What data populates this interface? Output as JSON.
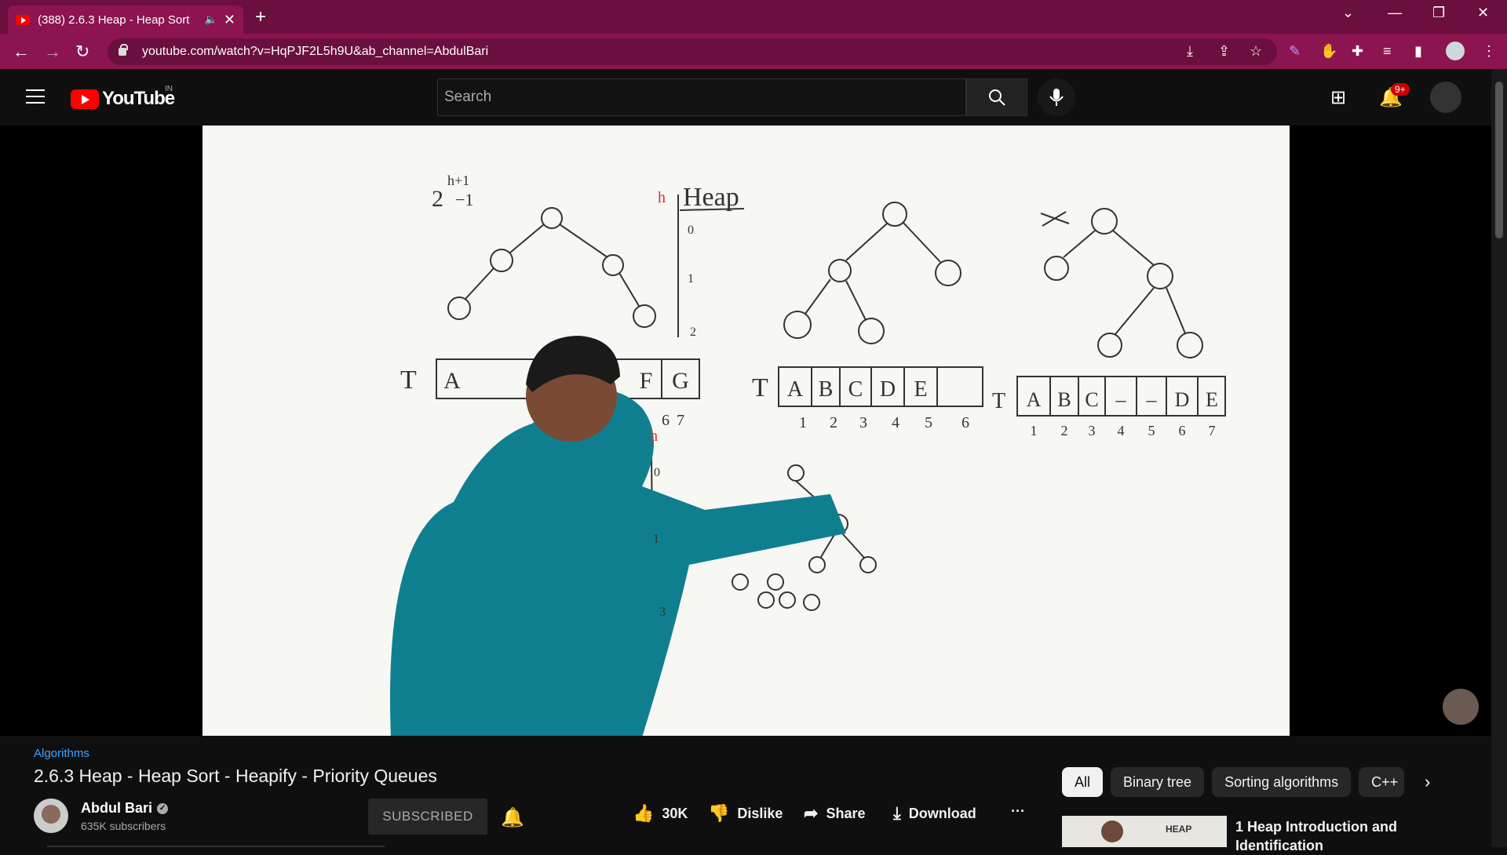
{
  "browser": {
    "tab_title": "(388) 2.6.3 Heap - Heap Sort",
    "url": "youtube.com/watch?v=HqPJF2L5h9U&ab_channel=AbdulBari",
    "theme_color": "#8c1450"
  },
  "youtube": {
    "logo_text": "YouTube",
    "country_code": "IN",
    "search_placeholder": "Search",
    "notifications_badge": "9+"
  },
  "video": {
    "hashtag": "Algorithms",
    "title": "2.6.3 Heap - Heap Sort - Heapify - Priority Queues",
    "board": {
      "heading": "Heap",
      "formula": "2",
      "formula_exp": "h+1",
      "formula_rest": "−1",
      "array1_label": "T",
      "array1_cells": [
        "A",
        "",
        "",
        "",
        "F",
        "G"
      ],
      "array1_indices": [
        "",
        "",
        "",
        "",
        "6",
        "7"
      ],
      "array2_label": "T",
      "array2_cells": [
        "A",
        "B",
        "C",
        "D",
        "E",
        ""
      ],
      "array2_indices": [
        "1",
        "2",
        "3",
        "4",
        "5",
        "6"
      ],
      "array3_label": "T",
      "array3_cells": [
        "A",
        "B",
        "C",
        "–",
        "–",
        "D",
        "E"
      ],
      "array3_indices": [
        "1",
        "2",
        "3",
        "4",
        "5",
        "6",
        "7"
      ],
      "height_marks": [
        "0",
        "1",
        "2"
      ],
      "height_marks2": [
        "0",
        "1",
        "3"
      ],
      "h_label": "h"
    }
  },
  "channel": {
    "name": "Abdul Bari",
    "subscribers": "635K subscribers",
    "subscribe_label": "SUBSCRIBED"
  },
  "actions": {
    "likes": "30K",
    "dislike": "Dislike",
    "share": "Share",
    "download": "Download",
    "more": "···"
  },
  "chips": [
    "All",
    "Binary tree",
    "Sorting algorithms",
    "C++"
  ],
  "recommendation": {
    "thumb_text": "HEAP",
    "title": "1 Heap Introduction and Identification"
  }
}
